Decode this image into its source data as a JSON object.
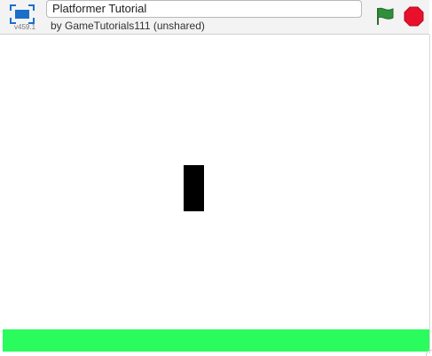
{
  "header": {
    "project_title": "Platformer Tutorial",
    "byline": "by GameTutorials111 (unshared)",
    "version": "v459.1",
    "fullscreen_icon": "fullscreen-icon",
    "green_flag_icon": "green-flag-icon",
    "stop_icon": "stop-icon"
  },
  "stage": {
    "background_color": "#ffffff",
    "ground_color": "#2bfc5e",
    "player_color": "#000000"
  },
  "colors": {
    "flag_green": "#2f8f3a",
    "stop_red": "#e8102a",
    "fullscreen_blue": "#1b6fc9"
  }
}
